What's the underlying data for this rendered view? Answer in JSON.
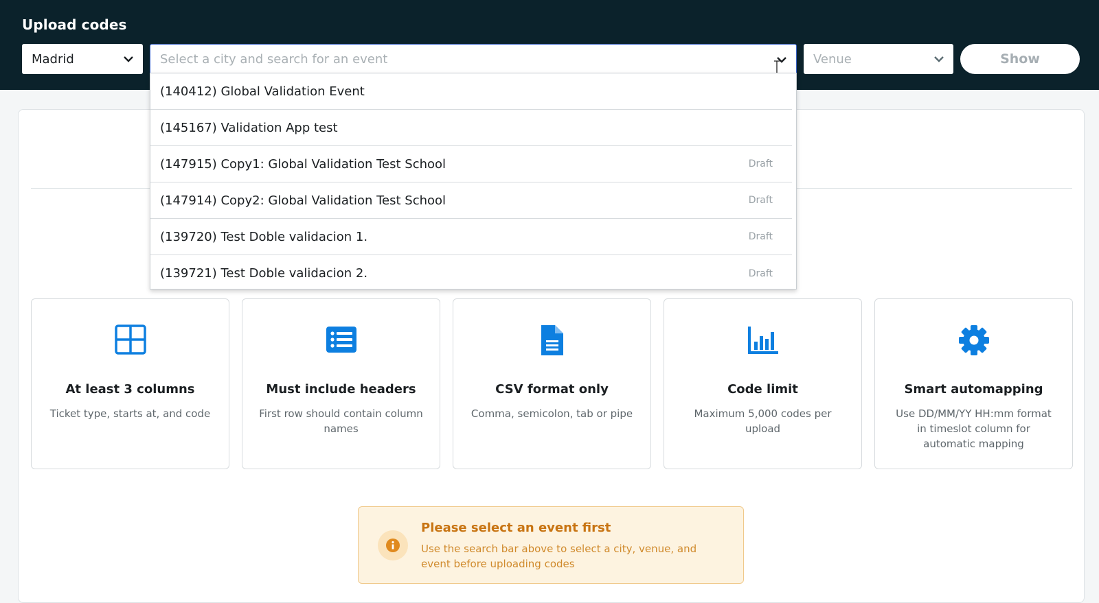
{
  "header": {
    "title": "Upload codes",
    "city_select": {
      "value": "Madrid"
    },
    "event_search": {
      "placeholder": "Select a city and search for an event",
      "value": ""
    },
    "venue_select": {
      "value": "Venue"
    },
    "show_button": "Show"
  },
  "dropdown": {
    "items": [
      {
        "label": "(140412) Global Validation Event",
        "badge": ""
      },
      {
        "label": "(145167) Validation App test",
        "badge": ""
      },
      {
        "label": "(147915) Copy1: Global Validation Test School",
        "badge": "Draft"
      },
      {
        "label": "(147914) Copy2: Global Validation Test School",
        "badge": "Draft"
      },
      {
        "label": "(139720) Test Doble validacion 1.",
        "badge": "Draft"
      },
      {
        "label": "(139721) Test Doble validacion 2.",
        "badge": "Draft"
      }
    ]
  },
  "features": [
    {
      "icon": "grid-icon",
      "title": "At least 3 columns",
      "description": "Ticket type, starts at, and code"
    },
    {
      "icon": "list-icon",
      "title": "Must include headers",
      "description": "First row should contain column names"
    },
    {
      "icon": "file-icon",
      "title": "CSV format only",
      "description": "Comma, semicolon, tab or pipe"
    },
    {
      "icon": "bar-chart-icon",
      "title": "Code limit",
      "description": "Maximum 5,000 codes per upload"
    },
    {
      "icon": "gear-icon",
      "title": "Smart automapping",
      "description": "Use DD/MM/YY HH:mm format in timeslot column for automatic mapping"
    }
  ],
  "alert": {
    "icon": "info-icon",
    "title": "Please select an event first",
    "description": "Use the search bar above to select a city, venue, and event before uploading codes"
  },
  "colors": {
    "header_bg": "#0b222b",
    "accent_blue": "#0d7fe0",
    "alert_title": "#c87412",
    "alert_bg": "#fdf3e0"
  }
}
